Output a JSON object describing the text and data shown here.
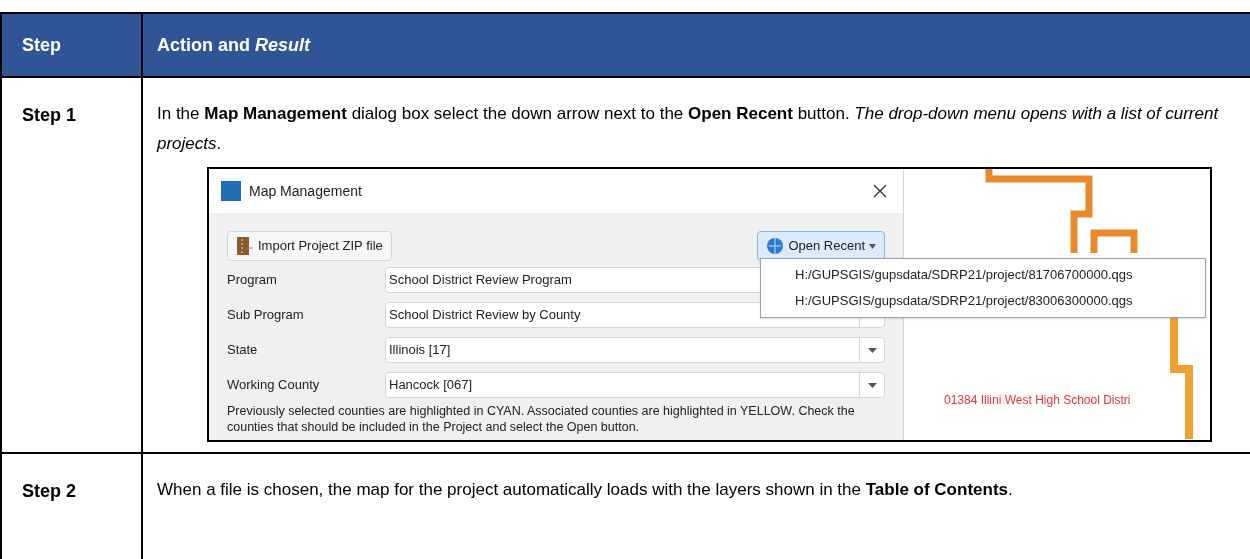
{
  "table": {
    "columns": [
      "Step",
      "Action and *Result*"
    ],
    "rows": [
      {
        "step": "Step 1",
        "text": "In the **Map Management** dialog box select the down arrow next to the **Open Recent** button. *The drop-down menu opens with a list of current projects*.",
        "screenshot": {
          "dialog": {
            "title": "Map Management",
            "import_button": "Import Project ZIP file",
            "open_recent_button": "Open Recent",
            "fields": [
              {
                "label": "Program",
                "value": "School District Review Program"
              },
              {
                "label": "Sub Program",
                "value": "School District Review by County"
              },
              {
                "label": "State",
                "value": "Illinois [17]"
              },
              {
                "label": "Working County",
                "value": "Hancock [067]"
              }
            ],
            "note": "Previously selected counties are highlighted in CYAN. Associated counties are highlighted in YELLOW. Check the counties that should be included in the Project and select the Open button."
          },
          "recent_menu": [
            "H:/GUPSGIS/gupsdata/SDRP21/project/81706700000.qgs",
            "H:/GUPSGIS/gupsdata/SDRP21/project/83006300000.qgs"
          ],
          "map_label": "01384 Illini West High School Distri"
        }
      },
      {
        "step": "Step 2",
        "text": "When a file is chosen, the map for the project automatically loads with the layers shown in the **Table of Contents**."
      }
    ]
  }
}
